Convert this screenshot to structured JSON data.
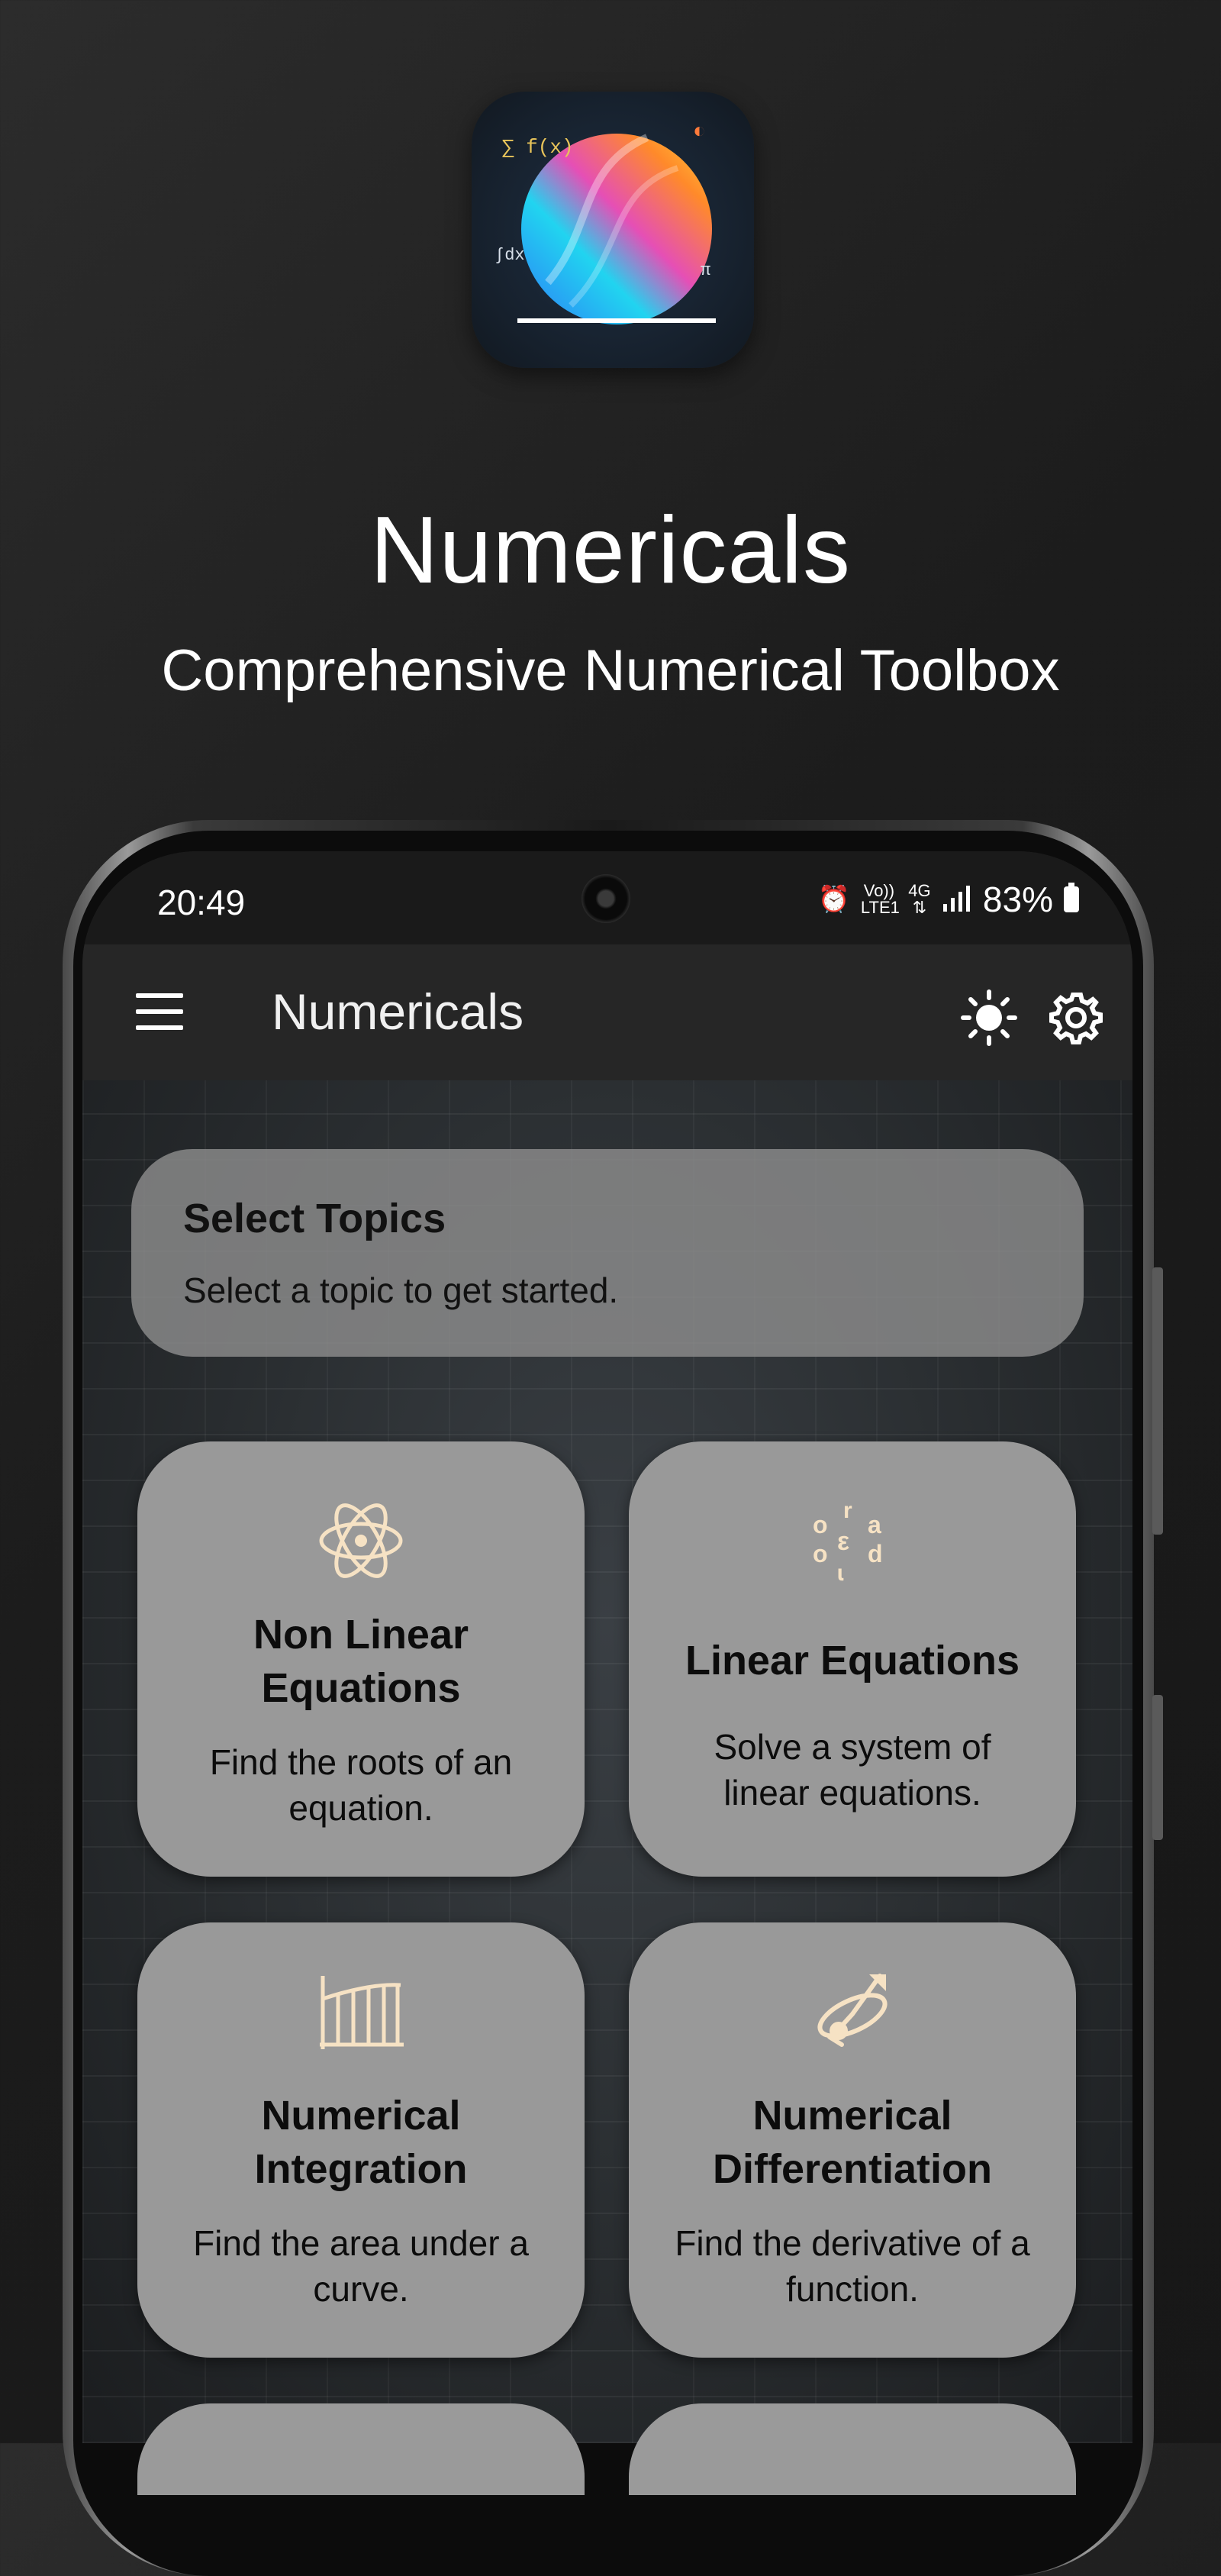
{
  "promo": {
    "title": "Numericals",
    "subtitle": "Comprehensive Numerical Toolbox"
  },
  "status_bar": {
    "time": "20:49",
    "alarm_icon": "alarm-icon",
    "volte_label": "Vo)) LTE1",
    "network_label": "4G",
    "signal_icon": "signal-bars-icon",
    "battery": "83%"
  },
  "app_bar": {
    "menu_icon": "hamburger-menu-icon",
    "title": "Numericals",
    "theme_icon": "sun-icon",
    "settings_icon": "gear-icon"
  },
  "header_card": {
    "title": "Select Topics",
    "subtitle": "Select a topic to get started."
  },
  "topics": [
    {
      "icon": "atom-icon",
      "title_line1": "Non Linear",
      "title_line2": "Equations",
      "desc_line1": "Find the roots of an",
      "desc_line2": "equation."
    },
    {
      "icon": "variables-icon",
      "title_line1": "Linear Equations",
      "title_line2": "",
      "desc_line1": "Solve a system of",
      "desc_line2": "linear equations."
    },
    {
      "icon": "integral-bars-icon",
      "title_line1": "Numerical",
      "title_line2": "Integration",
      "desc_line1": "Find the area under a",
      "desc_line2": "curve."
    },
    {
      "icon": "differentiation-icon",
      "title_line1": "Numerical",
      "title_line2": "Differentiation",
      "desc_line1": "Find the derivative of a",
      "desc_line2": "function."
    }
  ],
  "colors": {
    "icon_cream": "#f6e2c4",
    "card_grey": "#999999",
    "app_bar": "#262626"
  }
}
